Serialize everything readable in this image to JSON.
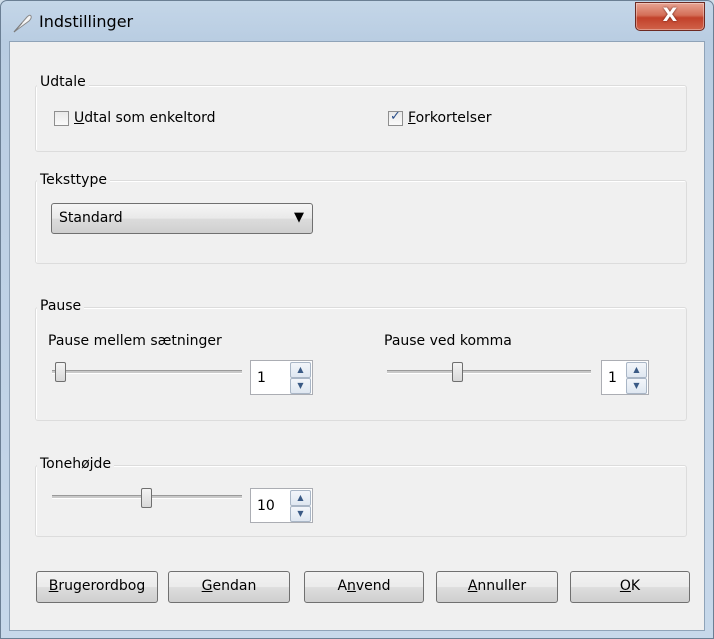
{
  "window": {
    "title": "Indstillinger",
    "close_glyph": "X"
  },
  "udtale": {
    "label": "Udtale",
    "enkeltord": {
      "mnemonic": "U",
      "rest": "dtal som enkeltord",
      "checked": false
    },
    "forkortelser": {
      "mnemonic": "F",
      "rest": "orkortelser",
      "checked": true
    }
  },
  "teksttype": {
    "label": "Teksttype",
    "selected": "Standard"
  },
  "pause": {
    "label": "Pause",
    "saetninger": {
      "label": "Pause mellem sætninger",
      "value": "1",
      "level": 0.0
    },
    "komma": {
      "label": "Pause ved komma",
      "value": "1",
      "level": 0.35
    }
  },
  "tonehojde": {
    "label": "Tonehøjde",
    "value": "10",
    "level": 0.5
  },
  "buttons": {
    "brugerordbog": {
      "mnemonic": "B",
      "rest": "rugerordbog"
    },
    "gendan": {
      "mnemonic": "G",
      "rest": "endan"
    },
    "anvend": {
      "pre": "A",
      "mnemonic": "n",
      "rest": "vend"
    },
    "annuller": {
      "mnemonic": "A",
      "rest": "nnuller"
    },
    "ok": {
      "mnemonic": "O",
      "rest": "K"
    }
  },
  "icons": {
    "title": "feather-pen-icon",
    "checkmark": "✓",
    "dropdown_arrow": "▼",
    "spin_up": "▲",
    "spin_down": "▼"
  }
}
